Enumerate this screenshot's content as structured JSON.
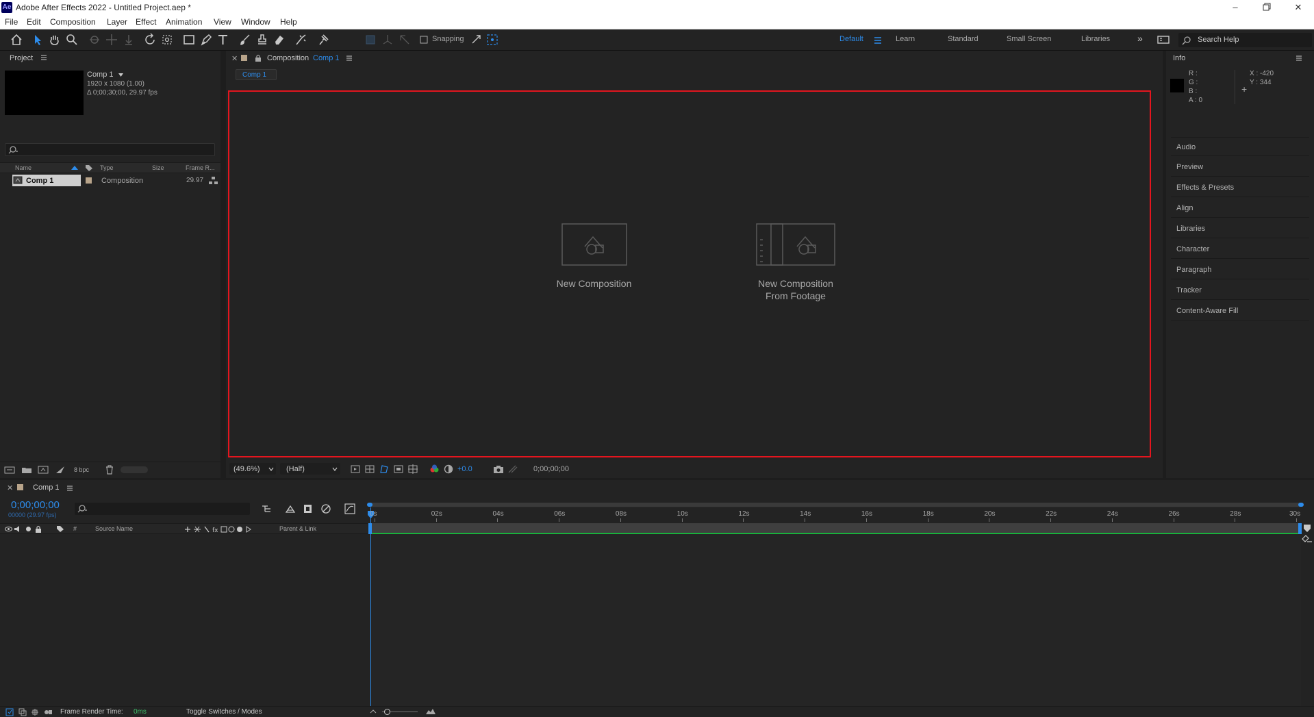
{
  "app": {
    "logo": "Ae",
    "title": "Adobe After Effects 2022 - Untitled Project.aep *"
  },
  "window_controls": {
    "minimize_icon": "minimize-icon",
    "restore_icon": "restore-icon",
    "close_icon": "close-icon"
  },
  "menu": [
    "File",
    "Edit",
    "Composition",
    "Layer",
    "Effect",
    "Animation",
    "View",
    "Window",
    "Help"
  ],
  "toolbar": {
    "snapping_label": "Snapping",
    "workspaces": [
      "Default",
      "Learn",
      "Standard",
      "Small Screen",
      "Libraries"
    ],
    "active_workspace": "Default",
    "overflow": "»",
    "search_placeholder": "Search Help"
  },
  "project": {
    "title": "Project",
    "item_name": "Comp 1",
    "item_dims": "1920 x 1080 (1.00)",
    "item_duration": "Δ 0;00;30;00, 29.97 fps",
    "columns": {
      "name": "Name",
      "type": "Type",
      "size": "Size",
      "frame_rate": "Frame R..."
    },
    "rows": [
      {
        "name": "Comp 1",
        "type": "Composition",
        "size": "",
        "frame_rate": "29.97"
      }
    ],
    "bpc": "8 bpc"
  },
  "viewer": {
    "tab_prefix": "Composition",
    "tab_comp": "Comp 1",
    "sub_tab": "Comp 1",
    "new_comp": "New Composition",
    "new_comp_footage_1": "New Composition",
    "new_comp_footage_2": "From Footage",
    "zoom": "(49.6%)",
    "resolution": "(Half)",
    "exposure": "+0.0",
    "timecode": "0;00;00;00"
  },
  "info": {
    "title": "Info",
    "r": "R :",
    "g": "G :",
    "b": "B :",
    "a": "A :  0",
    "x": "X : -420",
    "y": "Y : 344"
  },
  "right_panels": [
    "Audio",
    "Preview",
    "Effects & Presets",
    "Align",
    "Libraries",
    "Character",
    "Paragraph",
    "Tracker",
    "Content-Aware Fill"
  ],
  "timeline": {
    "tab": "Comp 1",
    "timecode": "0;00;00;00",
    "frame_info": "00000 (29.97 fps)",
    "columns": {
      "source_name": "Source Name",
      "parent_link": "Parent & Link",
      "hash": "#"
    },
    "ticks": [
      "0s",
      "02s",
      "04s",
      "06s",
      "08s",
      "10s",
      "12s",
      "14s",
      "16s",
      "18s",
      "20s",
      "22s",
      "24s",
      "26s",
      "28s",
      "30s"
    ],
    "render_time_label": "Frame Render Time:",
    "render_time_value": "0ms",
    "toggle_label": "Toggle Switches / Modes"
  },
  "colors": {
    "accent_blue": "#2d8ceb",
    "frame_red": "#e4151e",
    "work_area_green": "#19b13c",
    "label_tan": "#b8a48a"
  }
}
